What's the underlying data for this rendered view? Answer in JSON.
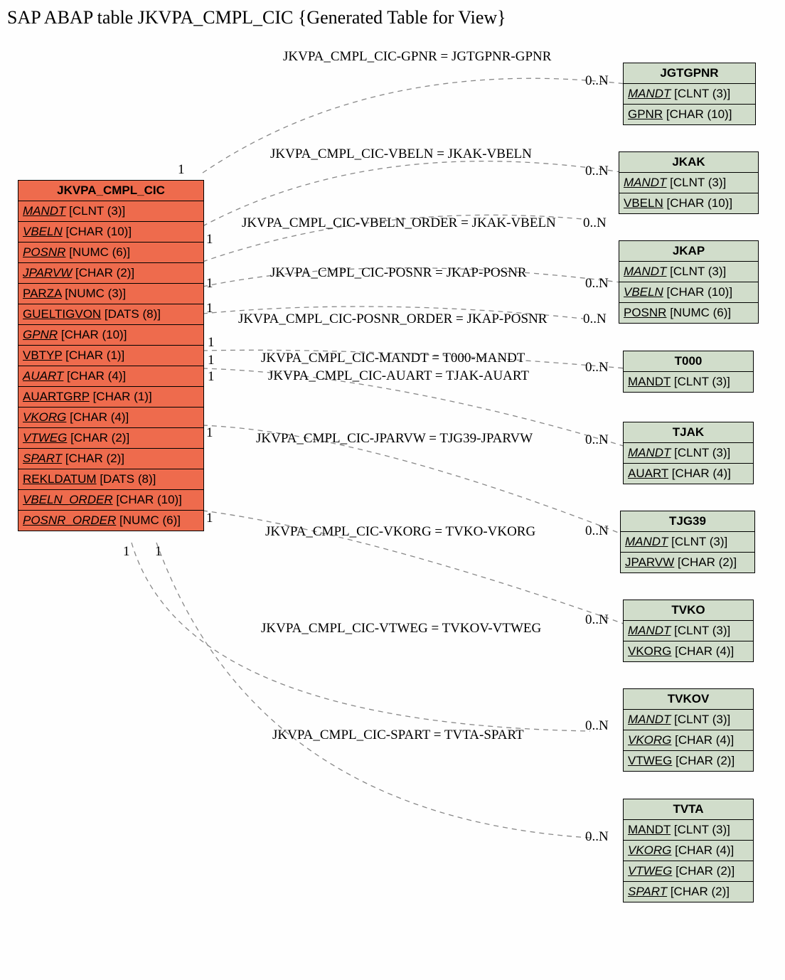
{
  "title": "SAP ABAP table JKVPA_CMPL_CIC {Generated Table for View}",
  "main_entity": {
    "name": "JKVPA_CMPL_CIC",
    "fields": [
      {
        "name": "MANDT",
        "type": "[CLNT (3)]",
        "italic": true
      },
      {
        "name": "VBELN",
        "type": "[CHAR (10)]",
        "italic": true
      },
      {
        "name": "POSNR",
        "type": "[NUMC (6)]",
        "italic": true
      },
      {
        "name": "JPARVW",
        "type": "[CHAR (2)]",
        "italic": true
      },
      {
        "name": "PARZA",
        "type": "[NUMC (3)]",
        "italic": false
      },
      {
        "name": "GUELTIGVON",
        "type": "[DATS (8)]",
        "italic": false
      },
      {
        "name": "GPNR",
        "type": "[CHAR (10)]",
        "italic": true
      },
      {
        "name": "VBTYP",
        "type": "[CHAR (1)]",
        "italic": false
      },
      {
        "name": "AUART",
        "type": "[CHAR (4)]",
        "italic": true
      },
      {
        "name": "AUARTGRP",
        "type": "[CHAR (1)]",
        "italic": false
      },
      {
        "name": "VKORG",
        "type": "[CHAR (4)]",
        "italic": true
      },
      {
        "name": "VTWEG",
        "type": "[CHAR (2)]",
        "italic": true
      },
      {
        "name": "SPART",
        "type": "[CHAR (2)]",
        "italic": true
      },
      {
        "name": "REKLDATUM",
        "type": "[DATS (8)]",
        "italic": false
      },
      {
        "name": "VBELN_ORDER",
        "type": "[CHAR (10)]",
        "italic": true
      },
      {
        "name": "POSNR_ORDER",
        "type": "[NUMC (6)]",
        "italic": true
      }
    ]
  },
  "ref_entities": [
    {
      "name": "JGTGPNR",
      "fields": [
        {
          "name": "MANDT",
          "type": "[CLNT (3)]",
          "italic": true
        },
        {
          "name": "GPNR",
          "type": "[CHAR (10)]",
          "italic": false
        }
      ]
    },
    {
      "name": "JKAK",
      "fields": [
        {
          "name": "MANDT",
          "type": "[CLNT (3)]",
          "italic": true
        },
        {
          "name": "VBELN",
          "type": "[CHAR (10)]",
          "italic": false
        }
      ]
    },
    {
      "name": "JKAP",
      "fields": [
        {
          "name": "MANDT",
          "type": "[CLNT (3)]",
          "italic": true
        },
        {
          "name": "VBELN",
          "type": "[CHAR (10)]",
          "italic": true
        },
        {
          "name": "POSNR",
          "type": "[NUMC (6)]",
          "italic": false
        }
      ]
    },
    {
      "name": "T000",
      "fields": [
        {
          "name": "MANDT",
          "type": "[CLNT (3)]",
          "italic": false
        }
      ]
    },
    {
      "name": "TJAK",
      "fields": [
        {
          "name": "MANDT",
          "type": "[CLNT (3)]",
          "italic": true
        },
        {
          "name": "AUART",
          "type": "[CHAR (4)]",
          "italic": false
        }
      ]
    },
    {
      "name": "TJG39",
      "fields": [
        {
          "name": "MANDT",
          "type": "[CLNT (3)]",
          "italic": true
        },
        {
          "name": "JPARVW",
          "type": "[CHAR (2)]",
          "italic": false
        }
      ]
    },
    {
      "name": "TVKO",
      "fields": [
        {
          "name": "MANDT",
          "type": "[CLNT (3)]",
          "italic": true
        },
        {
          "name": "VKORG",
          "type": "[CHAR (4)]",
          "italic": false
        }
      ]
    },
    {
      "name": "TVKOV",
      "fields": [
        {
          "name": "MANDT",
          "type": "[CLNT (3)]",
          "italic": true
        },
        {
          "name": "VKORG",
          "type": "[CHAR (4)]",
          "italic": true
        },
        {
          "name": "VTWEG",
          "type": "[CHAR (2)]",
          "italic": false
        }
      ]
    },
    {
      "name": "TVTA",
      "fields": [
        {
          "name": "MANDT",
          "type": "[CLNT (3)]",
          "italic": false
        },
        {
          "name": "VKORG",
          "type": "[CHAR (4)]",
          "italic": true
        },
        {
          "name": "VTWEG",
          "type": "[CHAR (2)]",
          "italic": true
        },
        {
          "name": "SPART",
          "type": "[CHAR (2)]",
          "italic": true
        }
      ]
    }
  ],
  "relations": [
    {
      "label": "JKVPA_CMPL_CIC-GPNR = JGTGPNR-GPNR"
    },
    {
      "label": "JKVPA_CMPL_CIC-VBELN = JKAK-VBELN"
    },
    {
      "label": "JKVPA_CMPL_CIC-VBELN_ORDER = JKAK-VBELN"
    },
    {
      "label": "JKVPA_CMPL_CIC-POSNR = JKAP-POSNR"
    },
    {
      "label": "JKVPA_CMPL_CIC-POSNR_ORDER = JKAP-POSNR"
    },
    {
      "label": "JKVPA_CMPL_CIC-MANDT = T000-MANDT"
    },
    {
      "label": "JKVPA_CMPL_CIC-AUART = TJAK-AUART"
    },
    {
      "label": "JKVPA_CMPL_CIC-JPARVW = TJG39-JPARVW"
    },
    {
      "label": "JKVPA_CMPL_CIC-VKORG = TVKO-VKORG"
    },
    {
      "label": "JKVPA_CMPL_CIC-VTWEG = TVKOV-VTWEG"
    },
    {
      "label": "JKVPA_CMPL_CIC-SPART = TVTA-SPART"
    }
  ],
  "left_card": "1",
  "right_card": "0..N"
}
